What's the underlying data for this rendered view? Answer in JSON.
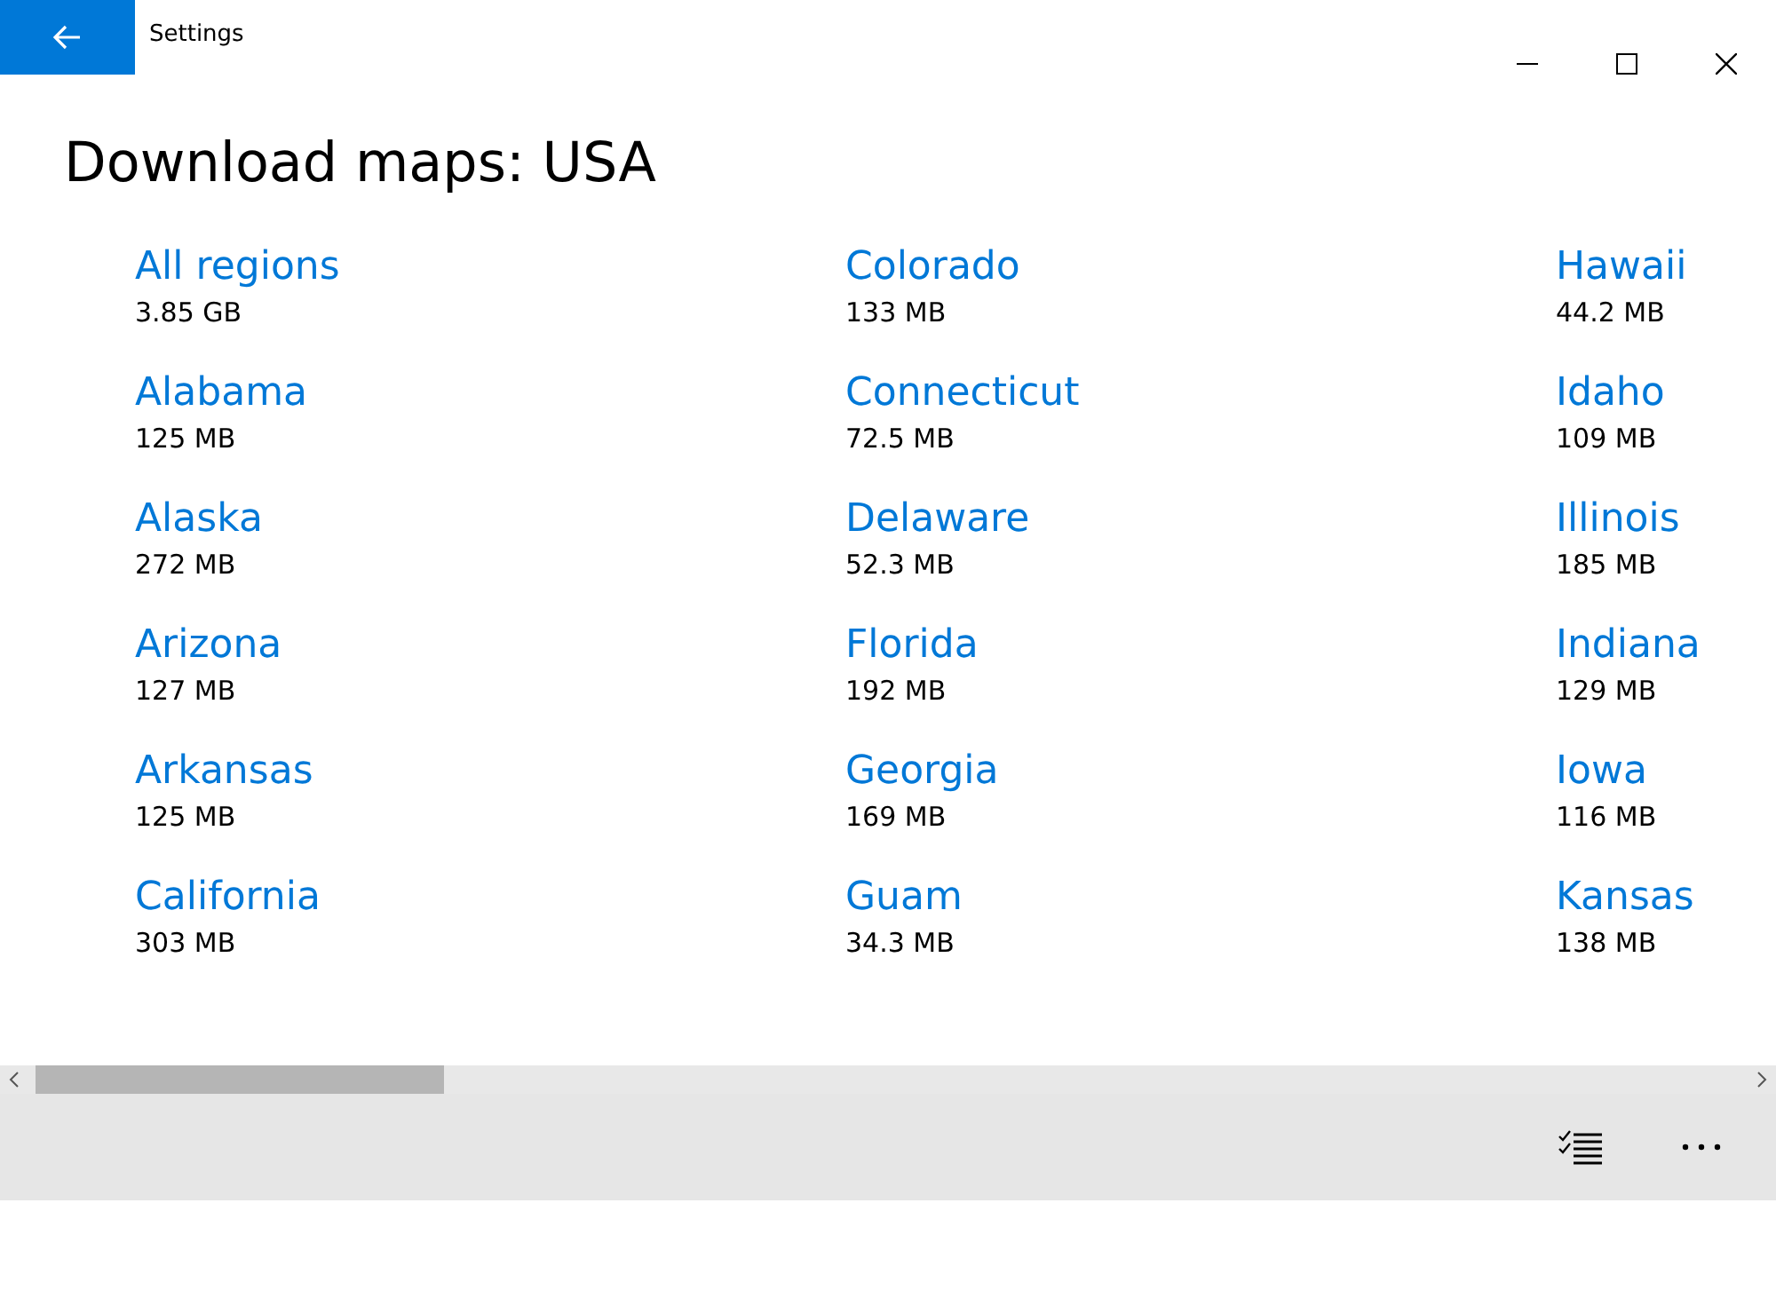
{
  "window": {
    "title": "Settings"
  },
  "heading": "Download maps: USA",
  "columns": [
    [
      {
        "name": "All regions",
        "size": "3.85 GB"
      },
      {
        "name": "Alabama",
        "size": "125 MB"
      },
      {
        "name": "Alaska",
        "size": "272 MB"
      },
      {
        "name": "Arizona",
        "size": "127 MB"
      },
      {
        "name": "Arkansas",
        "size": "125 MB"
      },
      {
        "name": "California",
        "size": "303 MB"
      }
    ],
    [
      {
        "name": "Colorado",
        "size": "133 MB"
      },
      {
        "name": "Connecticut",
        "size": "72.5 MB"
      },
      {
        "name": "Delaware",
        "size": "52.3 MB"
      },
      {
        "name": "Florida",
        "size": "192 MB"
      },
      {
        "name": "Georgia",
        "size": "169 MB"
      },
      {
        "name": "Guam",
        "size": "34.3 MB"
      }
    ],
    [
      {
        "name": "Hawaii",
        "size": "44.2 MB"
      },
      {
        "name": "Idaho",
        "size": "109 MB"
      },
      {
        "name": "Illinois",
        "size": "185 MB"
      },
      {
        "name": "Indiana",
        "size": "129 MB"
      },
      {
        "name": "Iowa",
        "size": "116 MB"
      },
      {
        "name": "Kansas",
        "size": "138 MB"
      }
    ]
  ]
}
